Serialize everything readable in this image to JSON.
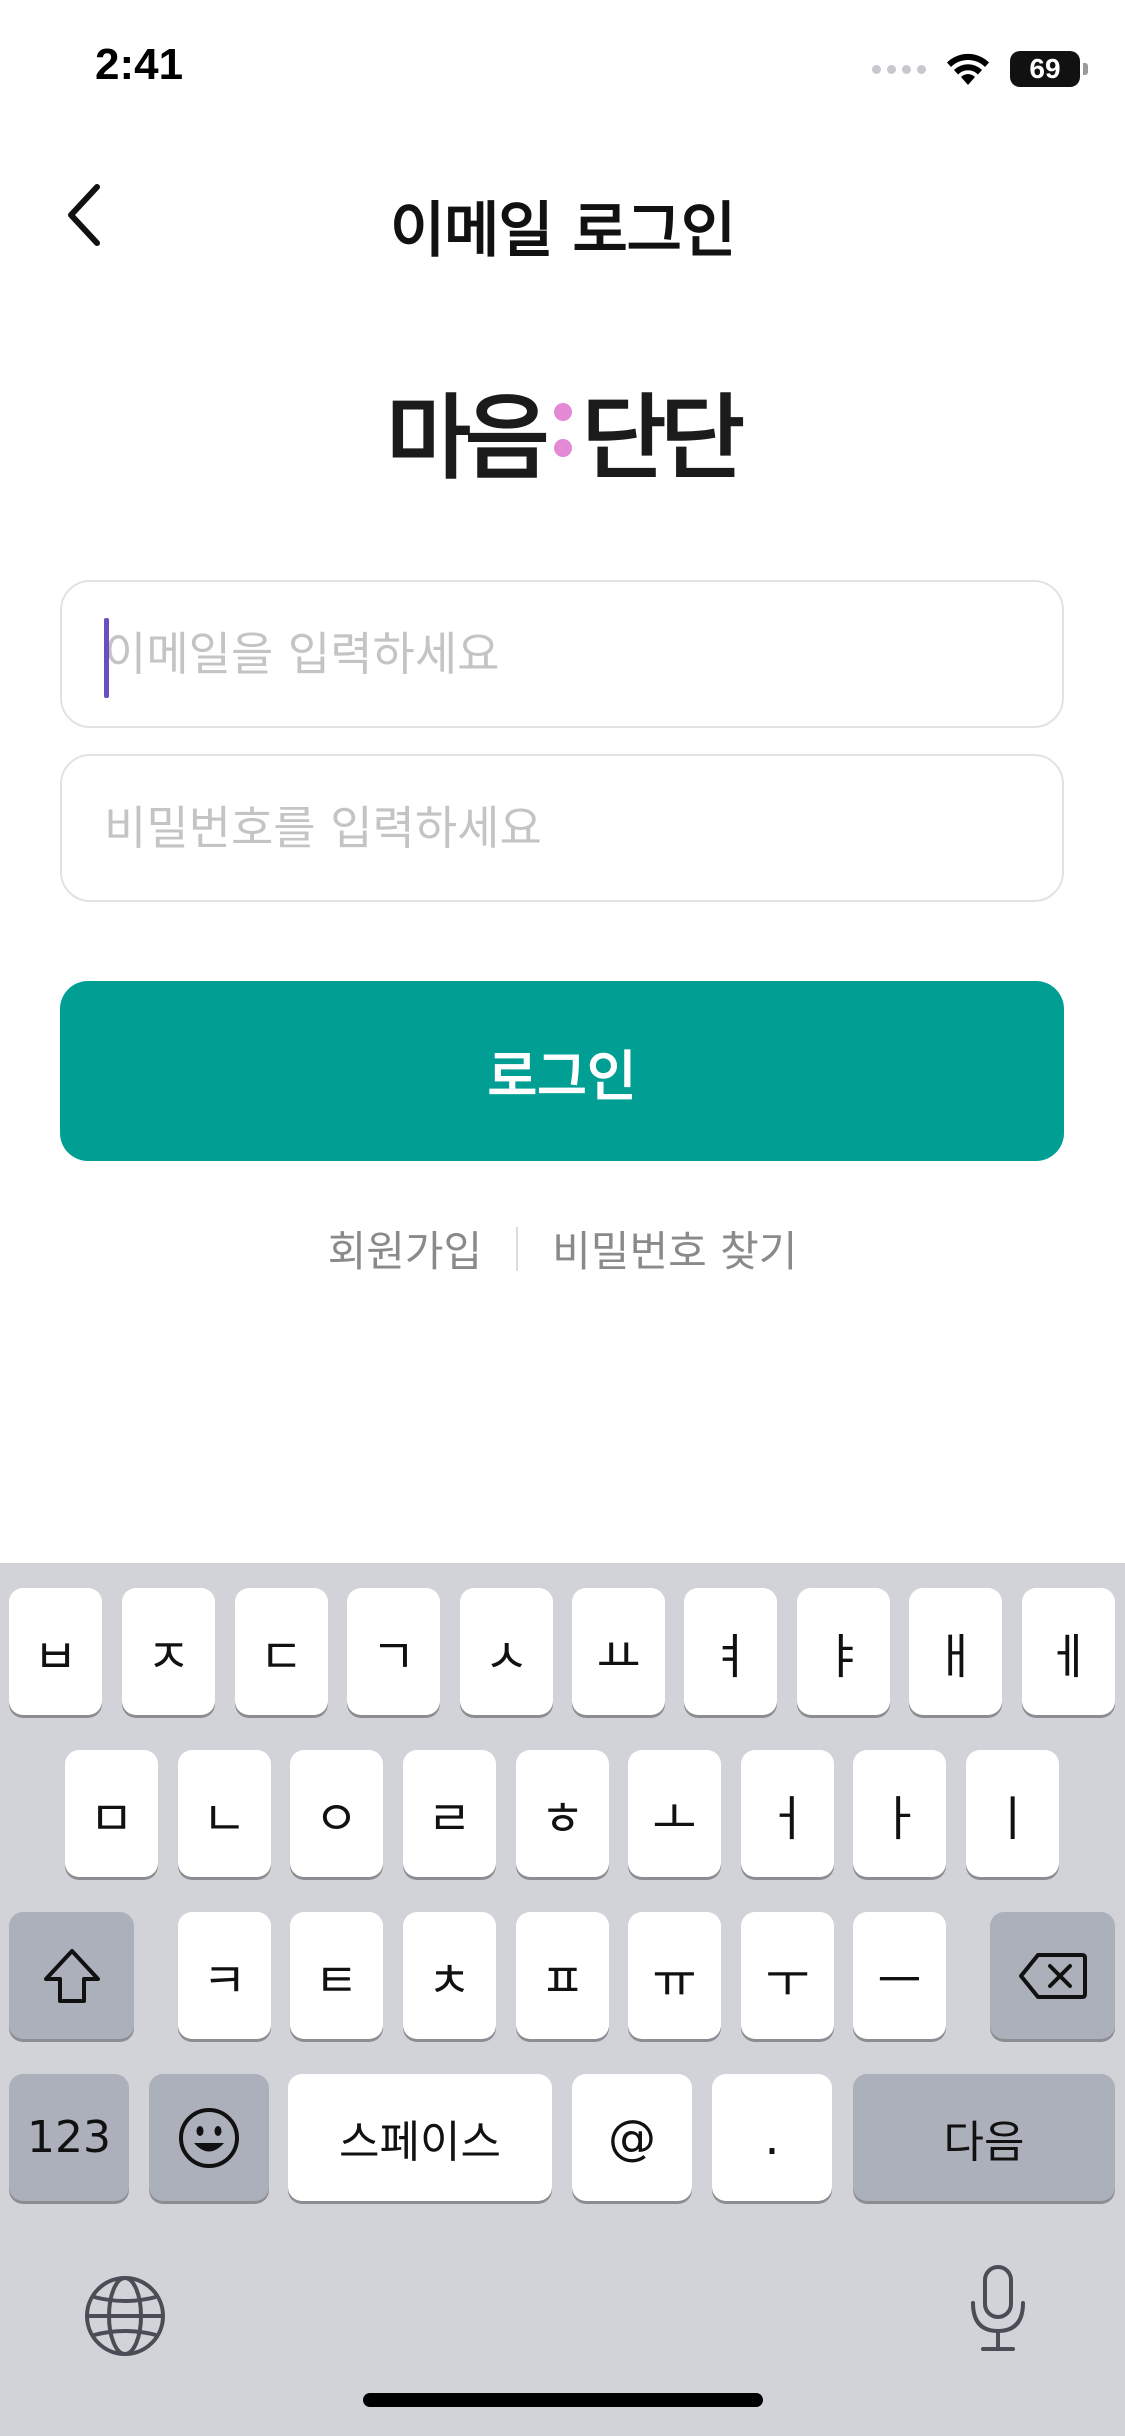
{
  "status_bar": {
    "time": "2:41",
    "battery": "69"
  },
  "nav": {
    "title": "이메일 로그인",
    "back_icon": "chevron-left-icon"
  },
  "logo": {
    "left": "마음",
    "right": "단단",
    "accent_color": "#e389d6"
  },
  "form": {
    "email_placeholder": "이메일을 입력하세요",
    "email_value": "",
    "password_placeholder": "비밀번호를 입력하세요",
    "password_value": ""
  },
  "login_button": {
    "label": "로그인",
    "color": "#009e93"
  },
  "links": {
    "signup": "회원가입",
    "find_password": "비밀번호 찾기"
  },
  "keyboard": {
    "row1": [
      "ㅂ",
      "ㅈ",
      "ㄷ",
      "ㄱ",
      "ㅅ",
      "ㅛ",
      "ㅕ",
      "ㅑ",
      "ㅐ",
      "ㅔ"
    ],
    "row2": [
      "ㅁ",
      "ㄴ",
      "ㅇ",
      "ㄹ",
      "ㅎ",
      "ㅗ",
      "ㅓ",
      "ㅏ",
      "ㅣ"
    ],
    "row3": [
      "ㅋ",
      "ㅌ",
      "ㅊ",
      "ㅍ",
      "ㅠ",
      "ㅜ",
      "ㅡ"
    ],
    "numbers": "123",
    "space": "스페이스",
    "at": "@",
    "period": ".",
    "next": "다음"
  }
}
